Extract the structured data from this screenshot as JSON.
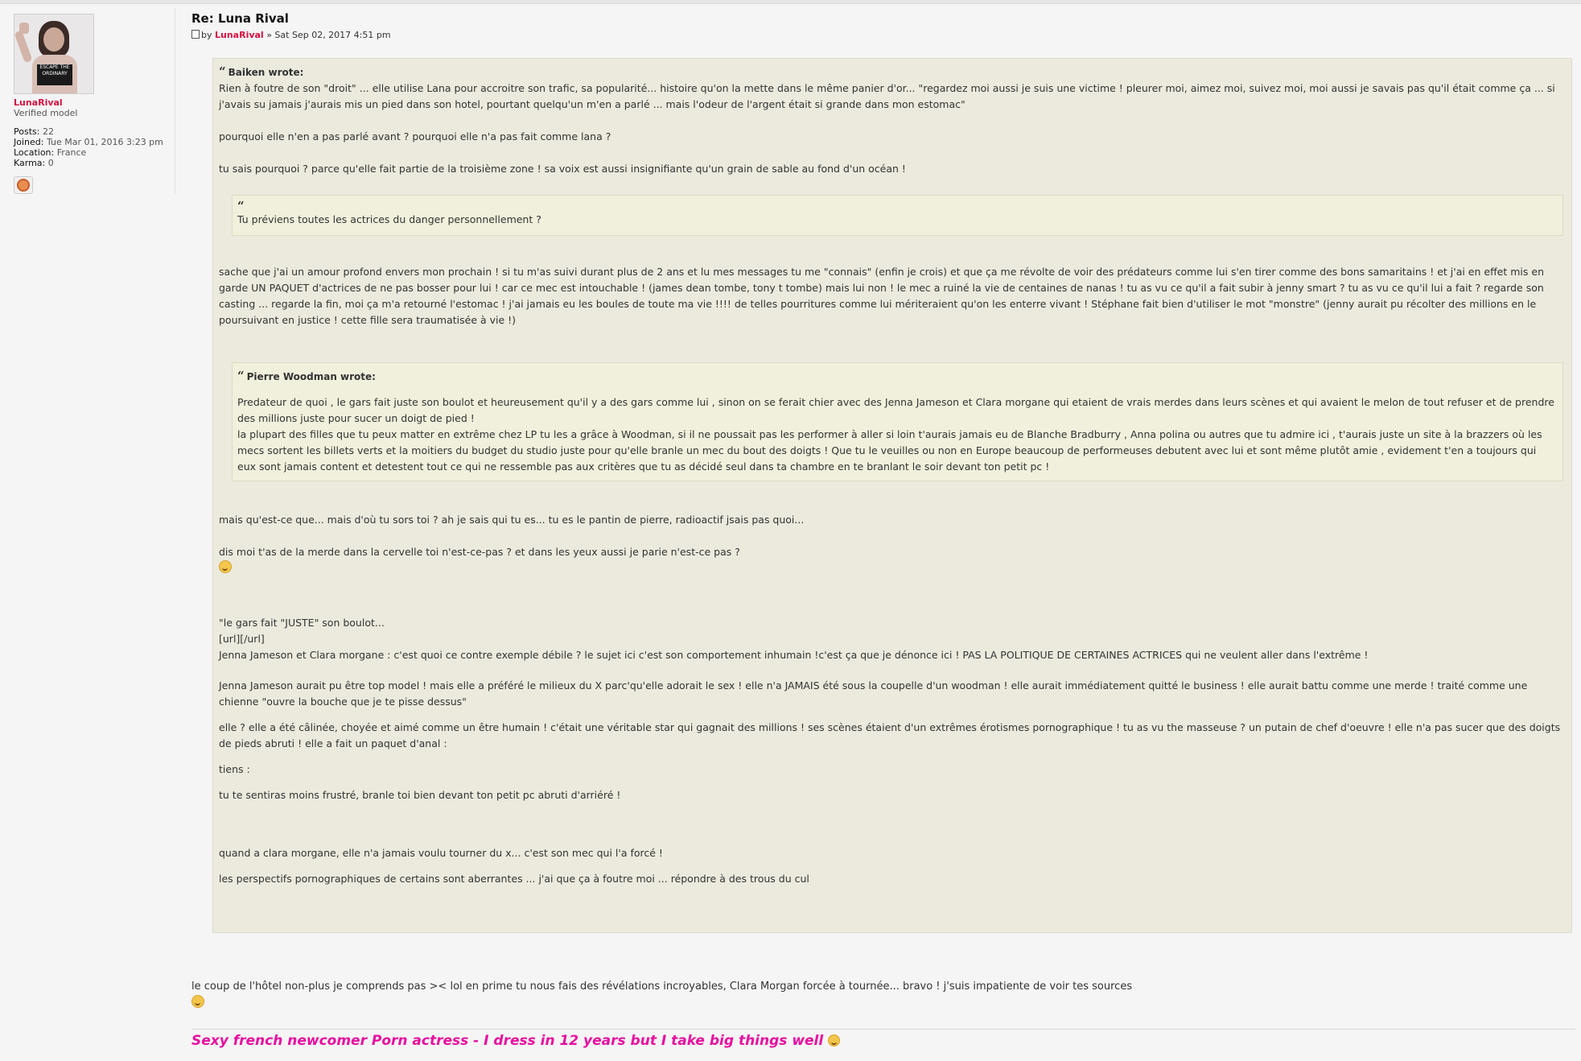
{
  "profile": {
    "username": "LunaRival",
    "rank": "Verified model",
    "stats": [
      {
        "key": "Posts:",
        "value": "22"
      },
      {
        "key": "Joined:",
        "value": "Tue Mar 01, 2016 3:23 pm"
      },
      {
        "key": "Location:",
        "value": "France"
      },
      {
        "key": "Karma:",
        "value": "0"
      }
    ],
    "avatar_top_text": "ESCAPE THE ORDINARY",
    "badge_icon": "donut-badge-icon"
  },
  "post": {
    "title": "Re: Luna Rival",
    "meta_by": "by",
    "meta_author": "LunaRival",
    "meta_date": "» Sat Sep 02, 2017 4:51 pm",
    "quote": {
      "cite": "Baiken wrote:",
      "p1": "Rien à foutre de son \"droit\" ... elle utilise Lana pour accroitre son trafic, sa popularité... histoire qu'on la mette dans le même panier d'or... \"regardez moi aussi je suis une victime ! pleurer moi, aimez moi, suivez moi, moi aussi je savais pas qu'il était comme ça ... si j'avais su jamais j'aurais mis un pied dans son hotel, pourtant quelqu'un m'en a parlé ... mais l'odeur de l'argent était si grande dans mon estomac\"",
      "p2": "pourquoi elle n'en a pas parlé avant ? pourquoi elle n'a pas fait comme lana ?",
      "p3": "tu sais pourquoi ? parce qu'elle fait partie de la troisième zone ! sa voix est aussi insignifiante qu'un grain de sable au fond d'un océan !",
      "inner1": "Tu préviens toutes les actrices du danger personnellement ?",
      "p4": "sache que j'ai un amour profond envers mon prochain ! si tu m'as suivi durant plus de 2 ans et lu mes messages tu me \"connais\" (enfin je crois) et que ça me révolte de voir des prédateurs comme lui s'en tirer comme des bons samaritains ! et j'ai en effet mis en garde UN PAQUET d'actrices de ne pas bosser pour lui ! car ce mec est intouchable ! (james dean tombe, tony t tombe) mais lui non ! le mec a ruiné la vie de centaines de nanas ! tu as vu ce qu'il a fait subir à jenny smart ? tu as vu ce qu'il lui a fait ? regarde son casting ... regarde la fin, moi ça m'a retourné l'estomac ! j'ai jamais eu les boules de toute ma vie !!!! de telles pourritures comme lui mériteraient qu'on les enterre vivant ! Stéphane fait bien d'utiliser le mot \"monstre\" (jenny aurait pu récolter des millions en le poursuivant en justice ! cette fille sera traumatisée à vie !)",
      "inner2_cite": "Pierre Woodman wrote:",
      "inner2_p1": "Predateur de quoi , le gars fait juste son boulot et heureusement qu'il y a des gars comme lui , sinon on se ferait chier avec des Jenna Jameson et Clara morgane qui etaient de vrais merdes dans leurs scènes et qui avaient le melon de tout refuser et de prendre des millions juste pour sucer un doigt de pied !",
      "inner2_p2": "la plupart des filles que tu peux matter en extrême chez LP tu les a grâce à Woodman, si il ne poussait pas les performer à aller si loin t'aurais jamais eu de Blanche Bradburry , Anna polina ou autres que tu admire ici , t'aurais juste un site à la brazzers où les mecs sortent les billets verts et la moitiers du budget du studio juste pour qu'elle branle un mec du bout des doigts ! Que tu le veuilles ou non en Europe beaucoup de performeuses debutent avec lui et sont même plutôt amie , evidement t'en a toujours qui eux sont jamais content et detestent tout ce qui ne ressemble pas aux critères que tu as décidé seul dans ta chambre en te branlant le soir devant ton petit pc !",
      "p5": "mais qu'est-ce que... mais d'où tu sors toi ? ah je sais qui tu es... tu es le pantin de pierre, radioactif jsais pas quoi...",
      "p6": "dis moi t'as de la merde dans la cervelle toi n'est-ce-pas ? et dans les yeux aussi je parie n'est-ce pas ?",
      "p7a": "\"le gars fait \"JUSTE\" son boulot...",
      "p7b": "[url][/url]",
      "p7c": "Jenna Jameson et Clara morgane : c'est quoi ce contre exemple débile ? le sujet ici c'est son comportement inhumain !c'est ça que je dénonce ici ! PAS LA POLITIQUE DE CERTAINES ACTRICES qui ne veulent aller dans l'extrême !",
      "p8": "Jenna Jameson aurait pu être top model ! mais elle a préféré le milieux du X parc'qu'elle adorait le sex ! elle n'a JAMAIS été sous la coupelle d'un woodman ! elle aurait immédiatement quitté le business ! elle aurait battu comme une merde ! traité comme une chienne \"ouvre la bouche que je te pisse dessus\"",
      "p9": "elle ? elle a été câlinée, choyée et aimé comme un être humain ! c'était une véritable star qui gagnait des millions ! ses scènes étaient d'un extrêmes érotismes pornographique ! tu as vu the masseuse ? un putain de chef d'oeuvre ! elle n'a pas sucer que des doigts de pieds abruti ! elle a fait un paquet d'anal :",
      "p10": "tiens :",
      "p11": "tu te sentiras moins frustré, branle toi bien devant ton petit pc abruti d'arriéré !",
      "p12": "quand a clara morgane, elle n'a jamais voulu tourner du x... c'est son mec qui l'a forcé !",
      "p13": "les perspectifs pornographiques de certains sont aberrantes ... j'ai que ça à foutre moi ... répondre à des trous du cul"
    },
    "reply": "le coup de l'hôtel non-plus je comprends pas >< lol en prime tu nous fais des révélations incroyables, Clara Morgan forcée à tournée... bravo ! j'suis impatiente de voir tes sources",
    "signature": "Sexy french newcomer Porn actress - I dress in 12 years but I take big things well"
  },
  "colors": {
    "username": "#d31141",
    "signature": "#e60ea0",
    "quote_bg": "#ebeadd",
    "inner_quote_bg": "#f1f0dc"
  }
}
